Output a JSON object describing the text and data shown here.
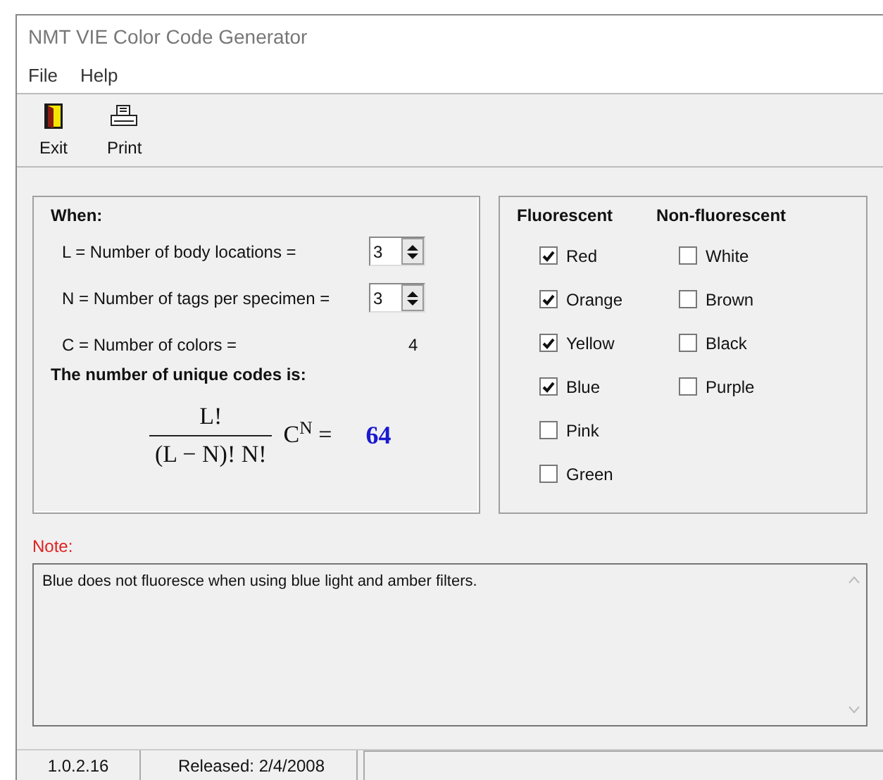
{
  "window": {
    "title": "NMT VIE Color Code Generator"
  },
  "menu": [
    "File",
    "Help"
  ],
  "toolbar": [
    {
      "kind": "exit",
      "label": "Exit"
    },
    {
      "kind": "print",
      "label": "Print"
    }
  ],
  "parameters": {
    "heading": "When:",
    "rows": [
      {
        "kind": "spinner",
        "label": "L = Number of body locations =",
        "value": "3"
      },
      {
        "kind": "spinner",
        "label": "N = Number of tags per specimen =",
        "value": "3"
      },
      {
        "kind": "readout",
        "label": "C = Number of colors =",
        "value": "4"
      }
    ],
    "result_heading": "The number of unique codes is:",
    "formula": {
      "numerator": "L!",
      "denominator": "(L − N)! N!",
      "factor": "C$^{N}$ =",
      "result": "64"
    }
  },
  "colors": [
    {
      "heading": "Fluorescent",
      "items": [
        {
          "label": "Red",
          "checked": true
        },
        {
          "label": "Orange",
          "checked": true
        },
        {
          "label": "Yellow",
          "checked": true
        },
        {
          "label": "Blue",
          "checked": true
        },
        {
          "label": "Pink",
          "checked": false
        },
        {
          "label": "Green",
          "checked": false
        }
      ]
    },
    {
      "heading": "Non-fluorescent",
      "items": [
        {
          "label": "White",
          "checked": false
        },
        {
          "label": "Brown",
          "checked": false
        },
        {
          "label": "Black",
          "checked": false
        },
        {
          "label": "Purple",
          "checked": false
        }
      ]
    }
  ],
  "note": {
    "label": "Note:",
    "text": "Blue does not fluoresce when using blue light and amber filters."
  },
  "status_bar": [
    "1.0.2.16",
    "Released: 2/4/2008"
  ]
}
